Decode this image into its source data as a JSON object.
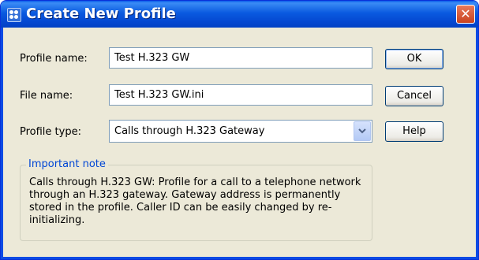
{
  "window": {
    "title": "Create New Profile",
    "close_glyph": "✕"
  },
  "form": {
    "profile_name": {
      "label": "Profile name:",
      "value": "Test H.323 GW"
    },
    "file_name": {
      "label": "File name:",
      "value": "Test H.323 GW.ini"
    },
    "profile_type": {
      "label": "Profile type:",
      "value": "Calls through H.323 Gateway"
    }
  },
  "buttons": {
    "ok": "OK",
    "cancel": "Cancel",
    "help": "Help"
  },
  "note": {
    "legend": "Important note",
    "text": "Calls through H.323 GW: Profile for a call to a telephone network through an H.323 gateway. Gateway address is permanently stored in the profile. Caller ID can be easily changed by re-initializing."
  }
}
